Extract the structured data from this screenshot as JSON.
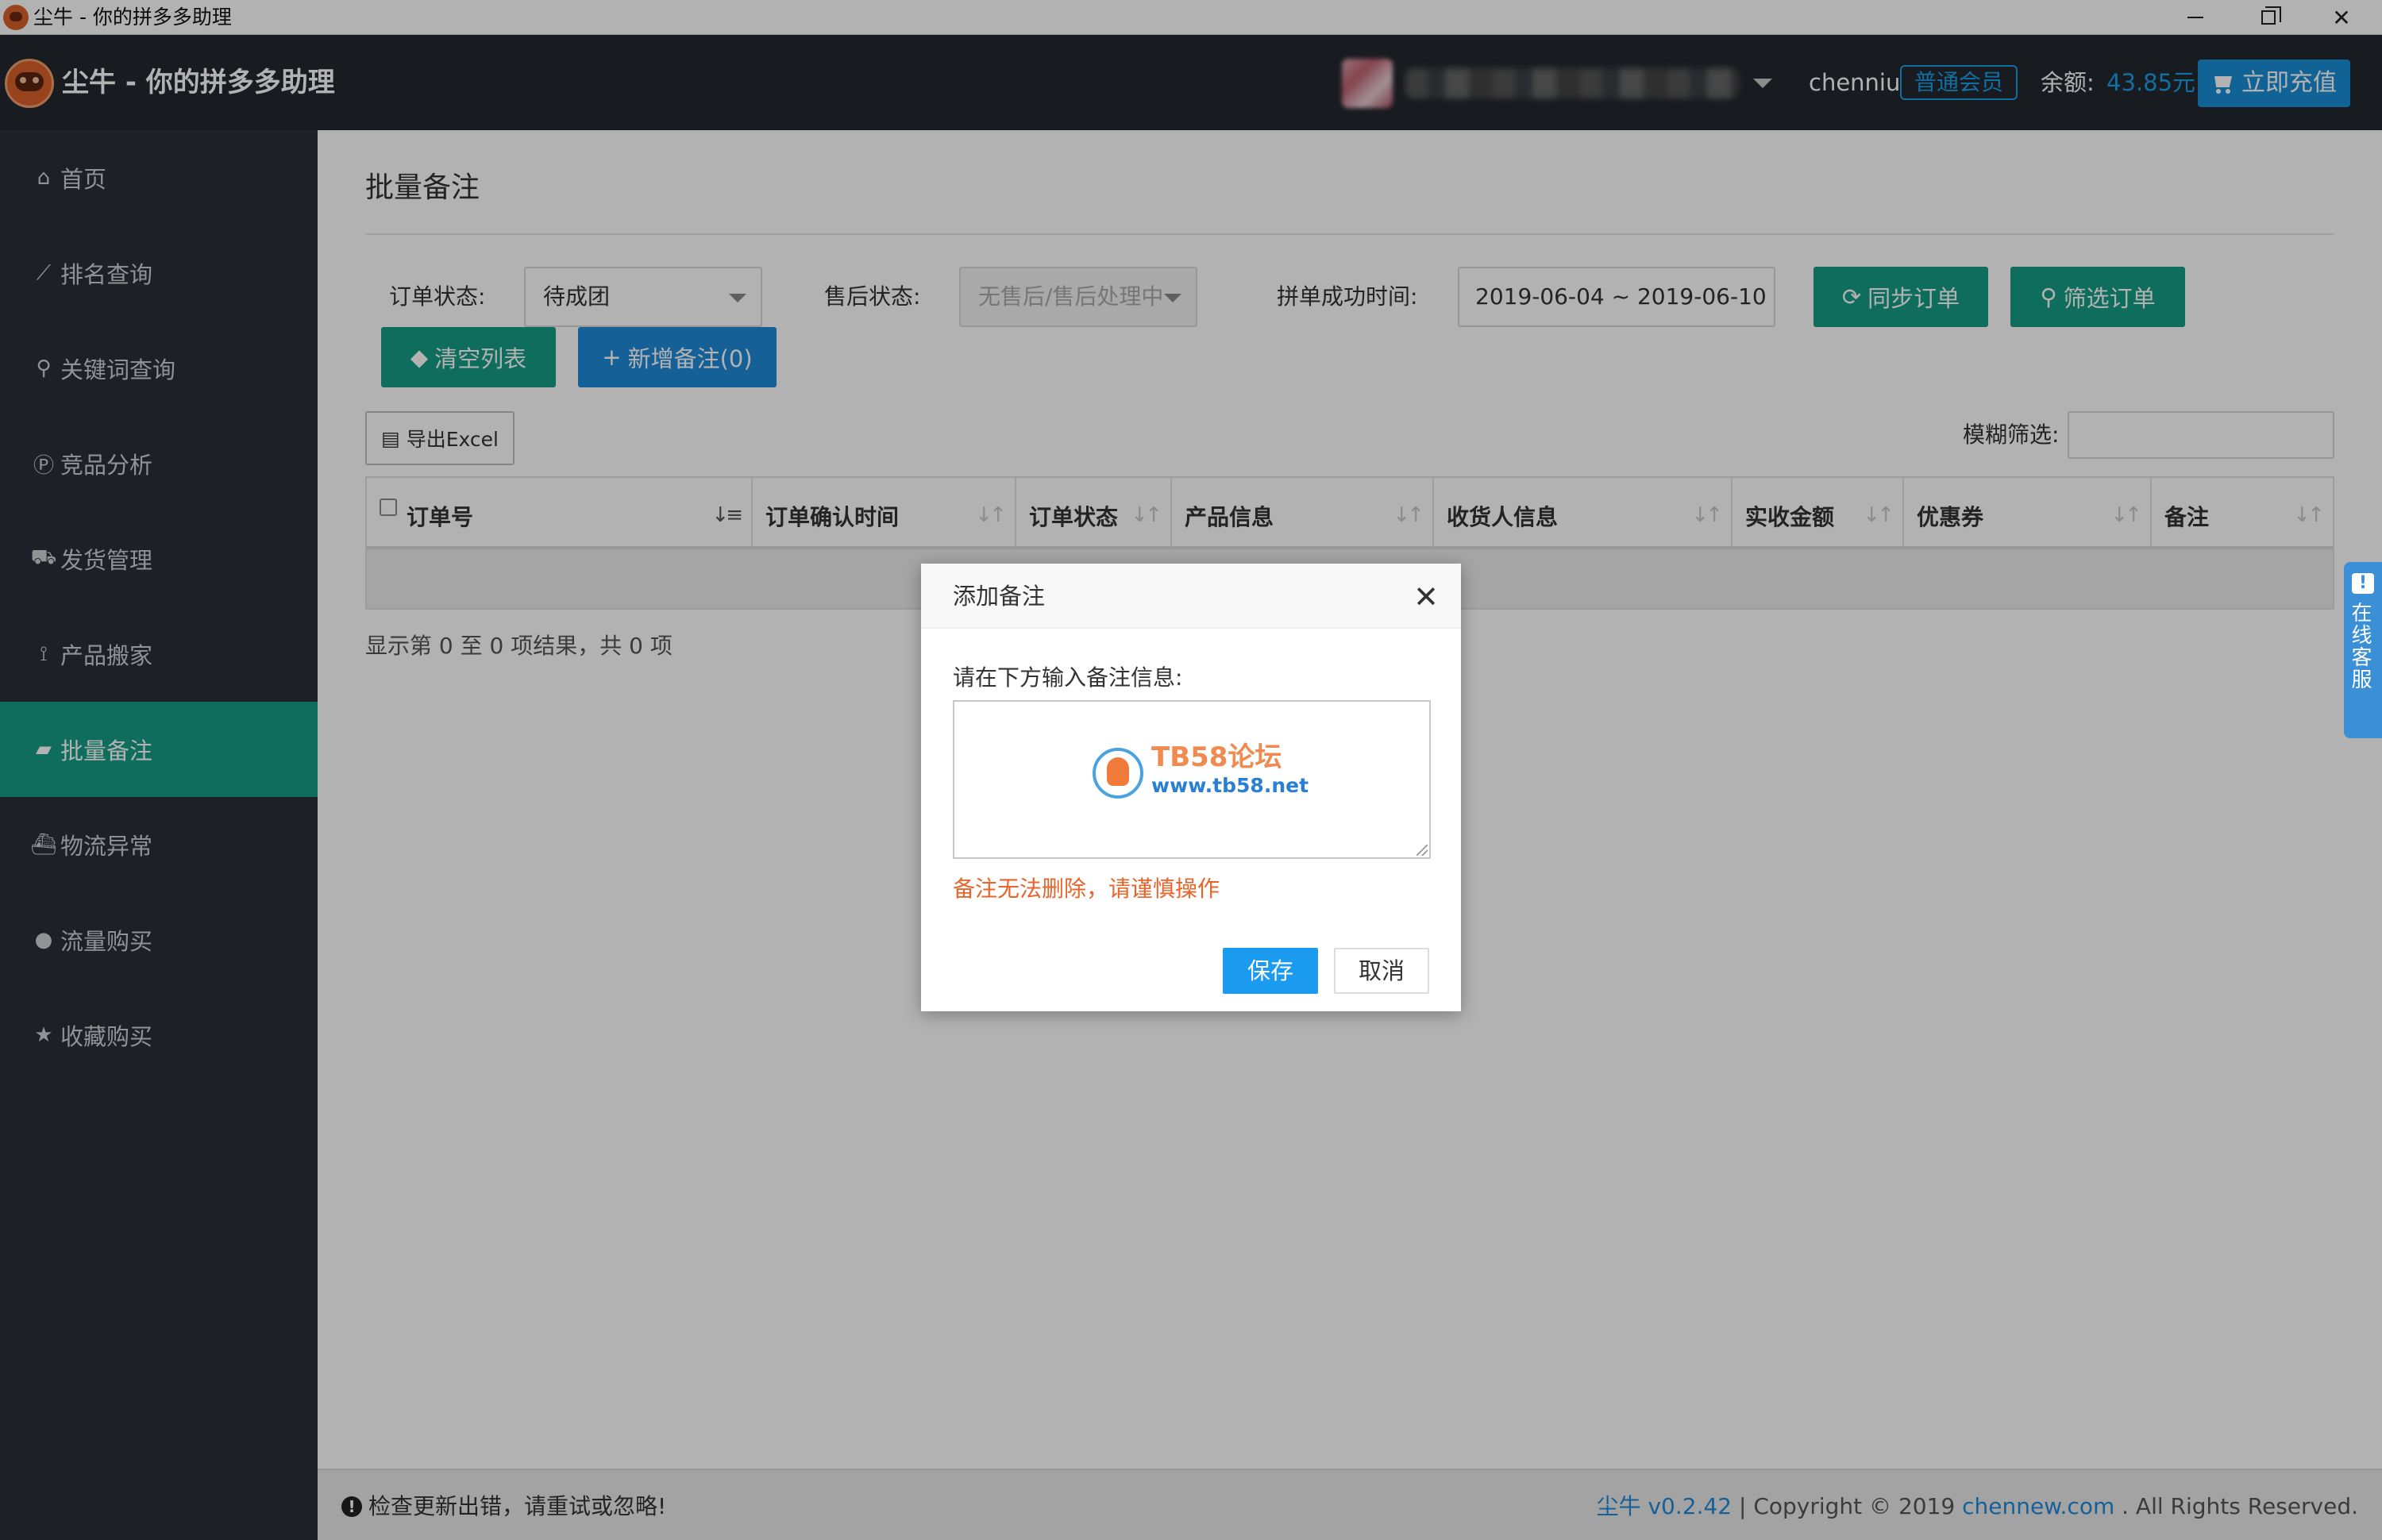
{
  "window": {
    "title": "尘牛 - 你的拼多多助理"
  },
  "header": {
    "app_title": "尘牛 - 你的拼多多助理",
    "username": "chenniu",
    "member_badge": "普通会员",
    "balance_label": "余额:",
    "balance_value": "43.85元",
    "recharge_label": "立即充值"
  },
  "sidebar": {
    "items": [
      {
        "label": "首页",
        "icon": "home-icon"
      },
      {
        "label": "排名查询",
        "icon": "line-chart-icon"
      },
      {
        "label": "关键词查询",
        "icon": "search-icon"
      },
      {
        "label": "竞品分析",
        "icon": "p-circle-icon"
      },
      {
        "label": "发货管理",
        "icon": "truck-icon"
      },
      {
        "label": "产品搬家",
        "icon": "dolly-icon"
      },
      {
        "label": "批量备注",
        "icon": "note-icon",
        "active": true
      },
      {
        "label": "物流异常",
        "icon": "ship-icon"
      },
      {
        "label": "流量购买",
        "icon": "lightbulb-icon"
      },
      {
        "label": "收藏购买",
        "icon": "star-icon"
      }
    ]
  },
  "main": {
    "page_title": "批量备注",
    "filters": {
      "order_status_label": "订单状态:",
      "order_status_value": "待成团",
      "after_sale_label": "售后状态:",
      "after_sale_placeholder": "无售后/售后处理中",
      "success_time_label": "拼单成功时间:",
      "success_time_value": "2019-06-04 ~ 2019-06-10",
      "sync_label": "同步订单",
      "filter_label": "筛选订单",
      "clear_label": "清空列表",
      "add_note_label": "新增备注(0)"
    },
    "export_label": "导出Excel",
    "fuzzy_label": "模糊筛选:",
    "fuzzy_value": "",
    "table": {
      "columns": [
        "订单号",
        "订单确认时间",
        "订单状态",
        "产品信息",
        "收货人信息",
        "实收金额",
        "优惠券",
        "备注"
      ],
      "rows": []
    },
    "info_text": "显示第 0 至 0 项结果，共 0 项"
  },
  "modal": {
    "title": "添加备注",
    "prompt": "请在下方输入备注信息:",
    "textarea_value": "",
    "watermark_title": "TB58论坛",
    "watermark_url": "www.tb58.net",
    "warning": "备注无法删除，请谨慎操作",
    "save_label": "保存",
    "cancel_label": "取消"
  },
  "side_tab": {
    "label": "在线客服"
  },
  "footer": {
    "warning": "检查更新出错，请重试或忽略!",
    "version": "尘牛 v0.2.42",
    "copyright_pre": " | Copyright © 2019 ",
    "site": "chennew.com",
    "copyright_post": " . All Rights Reserved."
  },
  "colors": {
    "sidebar_bg": "#2b2f3a",
    "header_bg": "#23272f",
    "accent_teal": "#159c85",
    "accent_blue": "#1f8bd8",
    "link_blue": "#1aa0e8",
    "warning_orange": "#e8642a"
  }
}
